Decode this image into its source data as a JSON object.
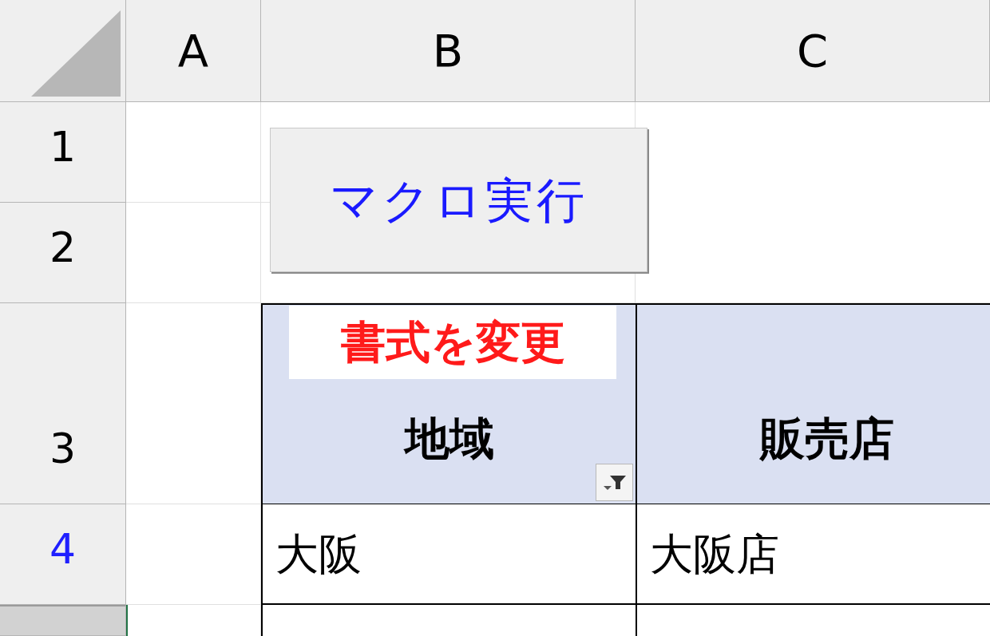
{
  "columns": [
    {
      "label": "A"
    },
    {
      "label": "B"
    },
    {
      "label": "C"
    }
  ],
  "row_headers": [
    {
      "label": "1",
      "highlighted": false,
      "selected": false
    },
    {
      "label": "2",
      "highlighted": false,
      "selected": false
    },
    {
      "label": "3",
      "highlighted": false,
      "selected": false
    },
    {
      "label": "4",
      "highlighted": true,
      "selected": false
    },
    {
      "selected": true
    }
  ],
  "macro_button": {
    "label": "マクロ実行"
  },
  "callout": {
    "text": "書式を変更"
  },
  "table": {
    "headers": [
      {
        "text": "地域",
        "filter": true
      },
      {
        "text": "販売店"
      }
    ],
    "rows": [
      [
        "大阪",
        "大阪店"
      ]
    ]
  }
}
